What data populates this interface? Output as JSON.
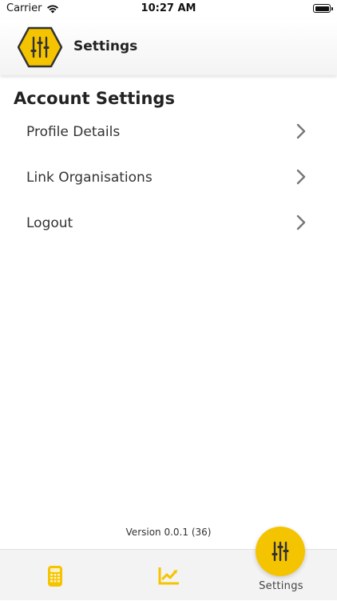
{
  "status_bar": {
    "carrier": "Carrier",
    "time": "10:27 AM"
  },
  "header": {
    "title": "Settings",
    "logo_icon": "sliders-hexagon-icon"
  },
  "section": {
    "title": "Account Settings"
  },
  "menu": {
    "items": [
      {
        "label": "Profile Details"
      },
      {
        "label": "Link Organisations"
      },
      {
        "label": "Logout"
      }
    ]
  },
  "footer": {
    "version": "Version 0.0.1 (36)"
  },
  "tabs": {
    "items": [
      {
        "icon": "calculator-icon",
        "label": ""
      },
      {
        "icon": "chart-icon",
        "label": ""
      },
      {
        "icon": "sliders-icon",
        "label": "Settings",
        "active": true
      }
    ]
  },
  "colors": {
    "accent": "#f5c400",
    "accent_dark": "#333333",
    "text": "#222222"
  }
}
